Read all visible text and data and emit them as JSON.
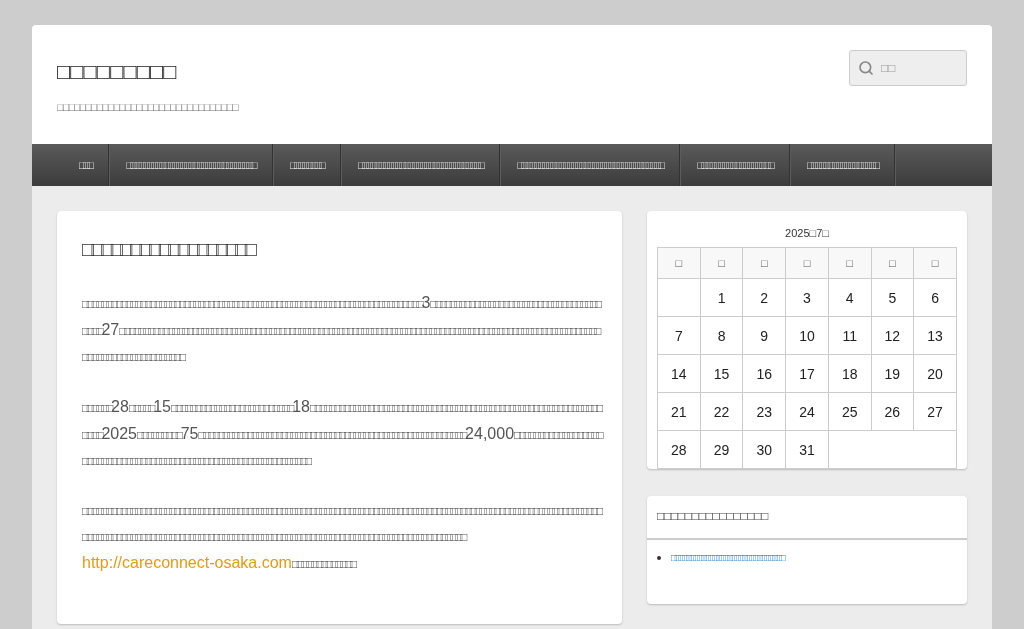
{
  "site": {
    "title": "□□□□□□□□□",
    "tagline": "□□□□□□□□□□□□□□□□□□□□□□□□□□□□□□□□"
  },
  "search": {
    "placeholder": "□□"
  },
  "nav": [
    {
      "label": "□□□"
    },
    {
      "label": "□□□□□□□□□□□□□□□□□□□□□□□□□□□□□□□"
    },
    {
      "label": "□□□□□□□□"
    },
    {
      "label": "□□□□□□□□□□□□□□□□□□□□□□□□□□□□□□"
    },
    {
      "label": "□□□□□□□□□□□□□□□□□□□□□□□□□□□□□□□□□□□"
    },
    {
      "label": "□□□□□□□□□□□□□□□□□□"
    },
    {
      "label": "□□□□□□□□□□□□□□□□□"
    }
  ],
  "post": {
    "title": "□□□□□□□□□□□□□□□□□□",
    "paragraphs": [
      {
        "text": "□□□□□□□□□□□□□□□□□□□□□□□□□□□□□□□□□□□□□□□□□□□□□□□□□□□□□□□□□□□□□□□□□□□□□□3□□□□□□□□□□□□□□□□□□□□□□□□□□□□□□□□□□□□□□□27□□□□□□□□□□□□□□□□□□□□□□□□□□□□□□□□□□□□□□□□□□□□□□□□□□□□□□□□□□□□□□□□□□□□□□□□□□□□□□□□□□□□□□□□□□□□□□□□□□□□□□□□□□□□□□□□□□□□□□□□"
      },
      {
        "text": "□□□□□□28□□□□□15□□□□□□□□□□□□□□□□□□□□□□□□□18□□□□□□□□□□□□□□□□□□□□□□□□□□□□□□□□□□□□□□□□□□□□□□□□□□□□□□□□□□□□□□□□2025□□□□□□□□□75□□□□□□□□□□□□□□□□□□□□□□□□□□□□□□□□□□□□□□□□□□□□□□□□□□□□□□□24,000□□□□□□□□□□□□□□□□□□□□□□□□□□□□□□□□□□□□□□□□□□□□□□□□□□□□□□□□□□□□□□□□□"
      },
      {
        "text": "□□□□□□□□□□□□□□□□□□□□□□□□□□□□□□□□□□□□□□□□□□□□□□□□□□□□□□□□□□□□□□□□□□□□□□□□□□□□□□□□□□□□□□□□□□□□□□□□□□□□□□□□□□□□□□□□□□□□□□□□□□□□□□□□□□□□□□□□□□□□□□□□□□□□□□□□□□□□□□□□□□□□□□□□□□□□□□□□□□□□□□□□□□",
        "link": "http://careconnect-osaka.com",
        "after": "□□□□□□□□□□□□□"
      }
    ]
  },
  "calendar": {
    "caption": "2025□7□",
    "weekdays": [
      "□",
      "□",
      "□",
      "□",
      "□",
      "□",
      "□"
    ],
    "weeks": [
      {
        "leading_blank": true,
        "days": [
          "1",
          "2",
          "3",
          "4",
          "5",
          "6"
        ]
      },
      {
        "days": [
          "7",
          "8",
          "9",
          "10",
          "11",
          "12",
          "13"
        ]
      },
      {
        "days": [
          "14",
          "15",
          "16",
          "17",
          "18",
          "19",
          "20"
        ]
      },
      {
        "days": [
          "21",
          "22",
          "23",
          "24",
          "25",
          "26",
          "27"
        ]
      },
      {
        "days": [
          "28",
          "29",
          "30",
          "31"
        ],
        "trailing_blank": true
      }
    ]
  },
  "widget": {
    "title": "□□□□□□□□□□□□□□□□",
    "links": [
      "□□□□□□□□□□□□□□□□□□□□□□□□□□□□□□"
    ]
  }
}
